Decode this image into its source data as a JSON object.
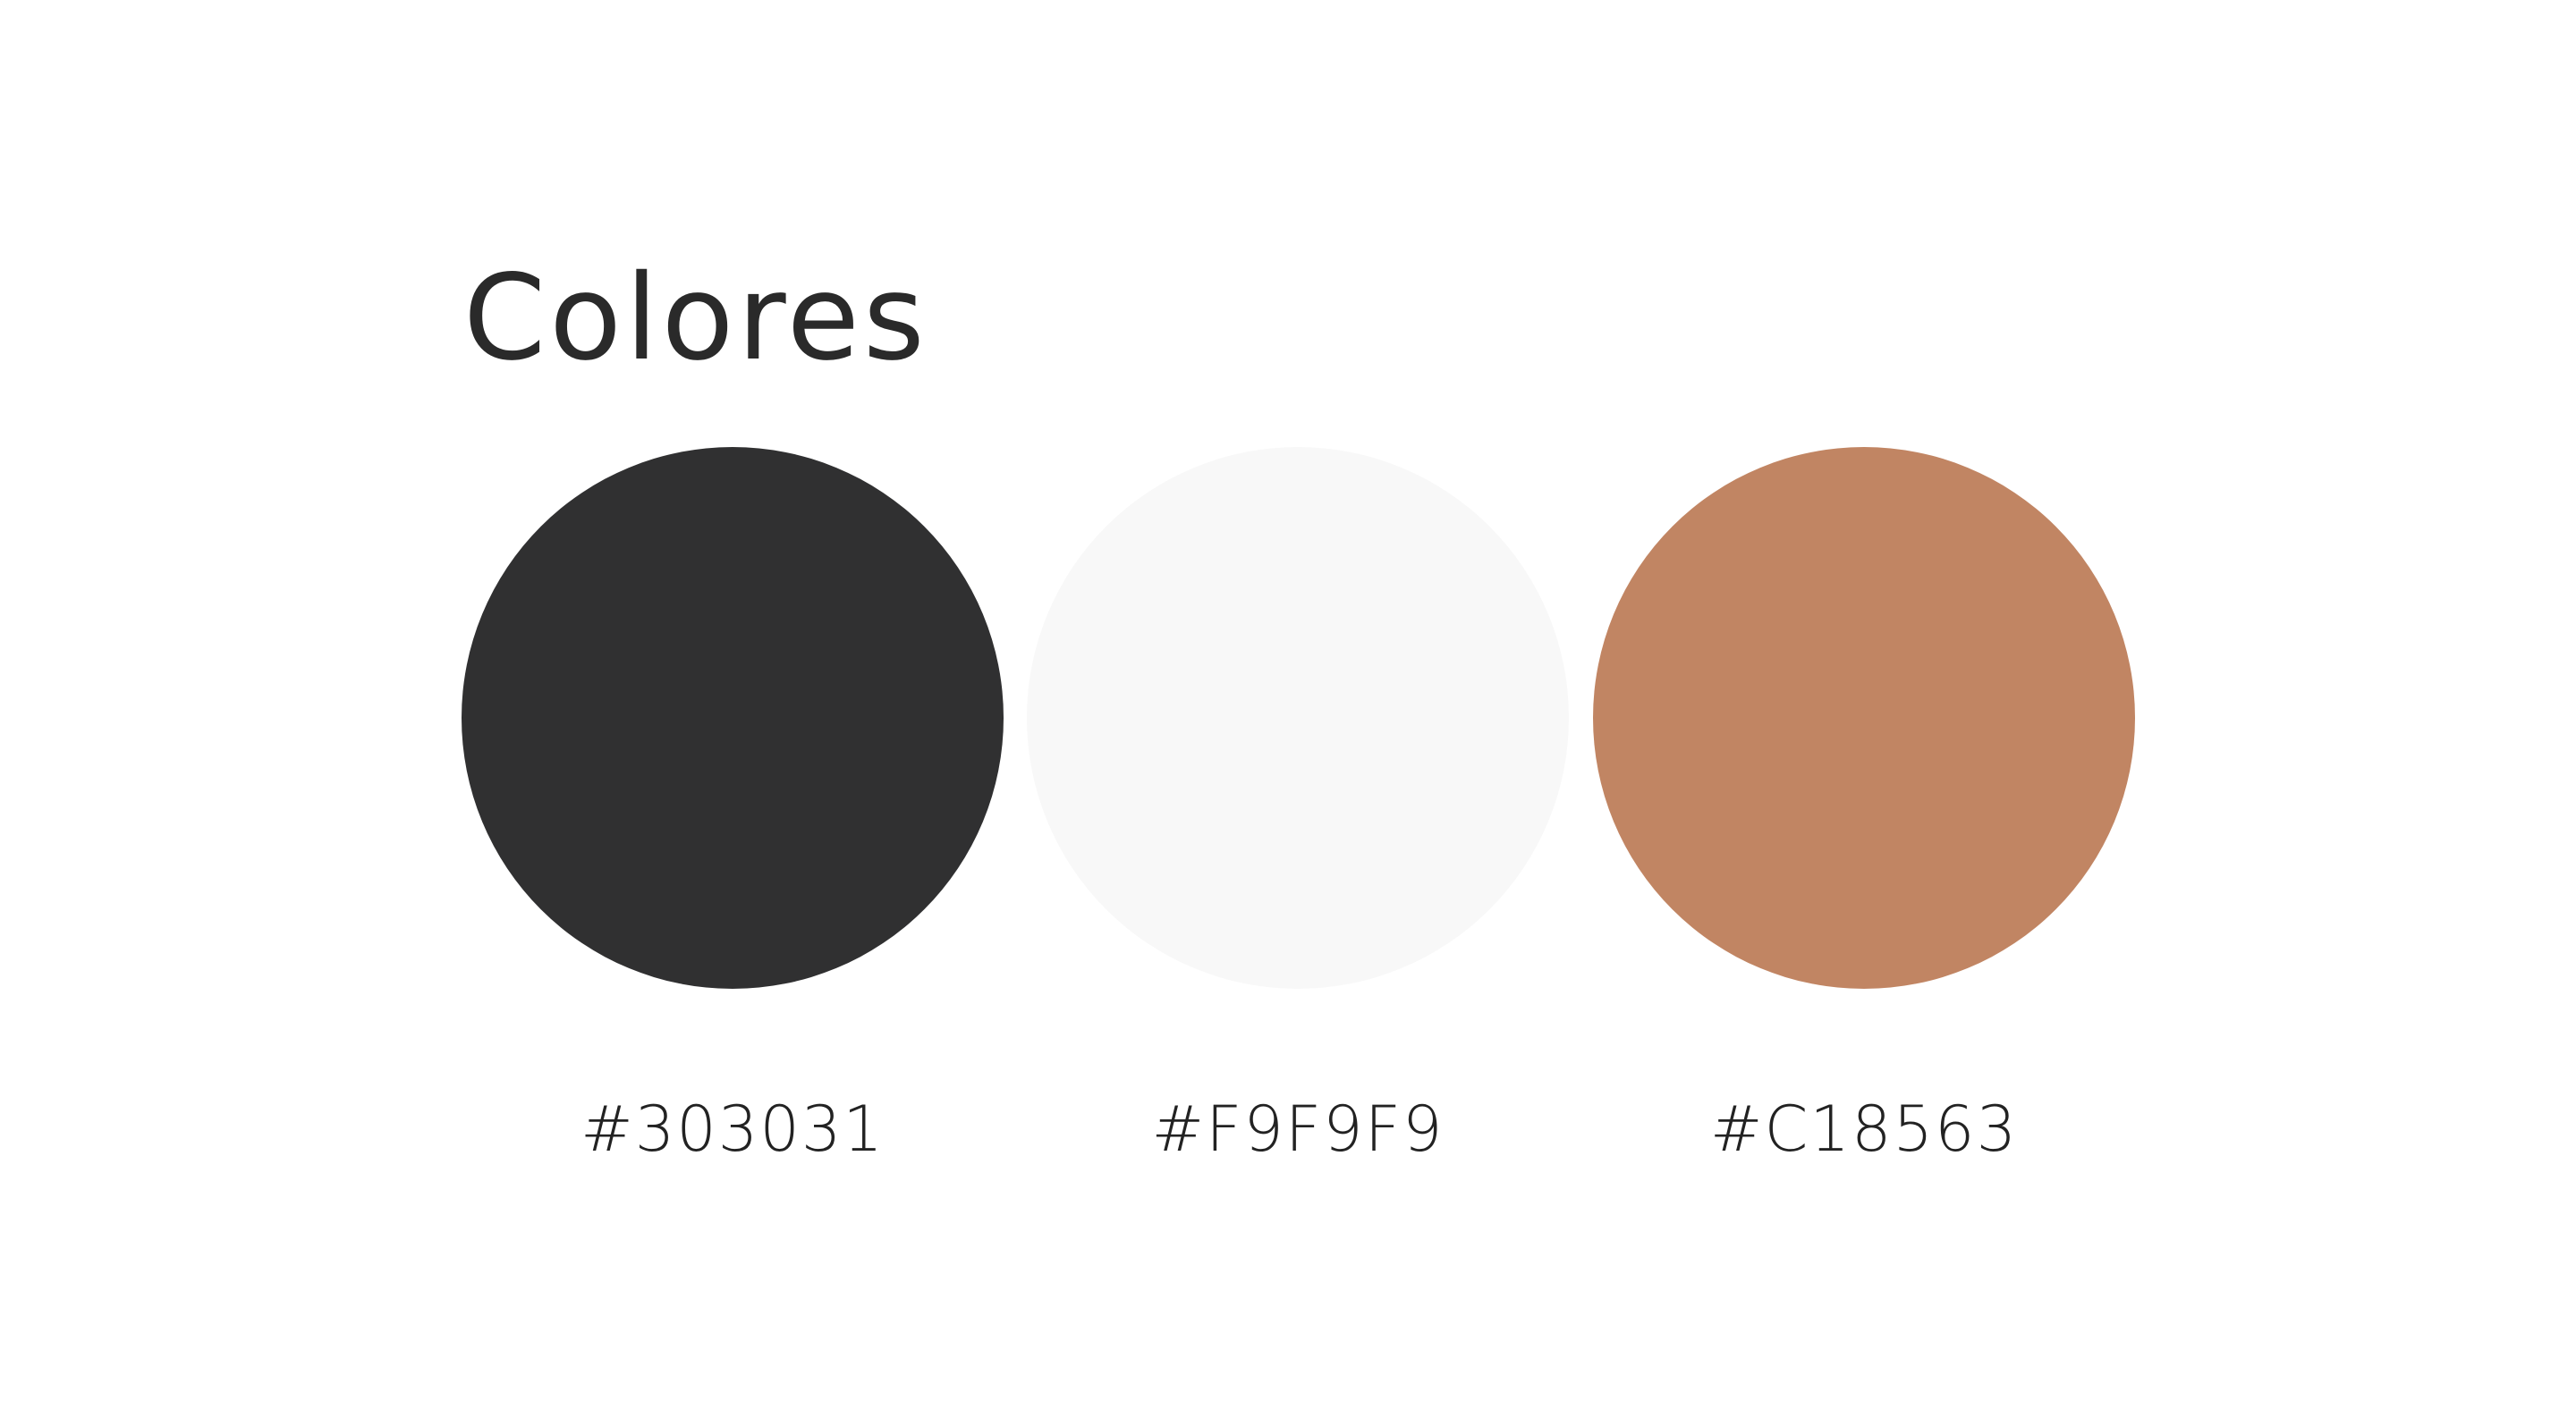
{
  "title": "Colores",
  "swatches": [
    {
      "hex_label": "#303031",
      "color": "#303031"
    },
    {
      "hex_label": "#F9F9F9",
      "color": "#F8F8F8"
    },
    {
      "hex_label": "#C18563",
      "color": "#C18563"
    }
  ]
}
